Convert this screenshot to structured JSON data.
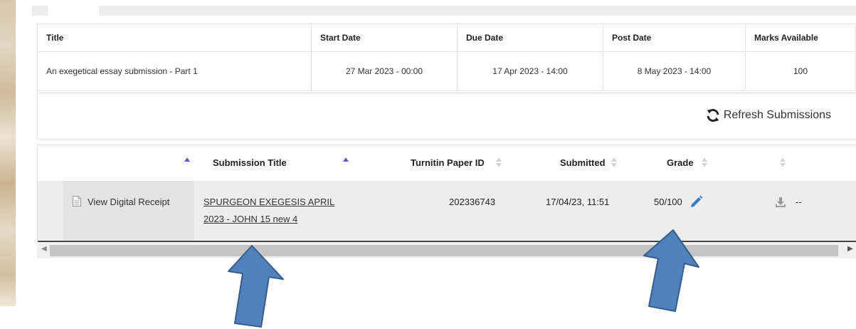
{
  "assignment": {
    "headers": {
      "title": "Title",
      "start_date": "Start Date",
      "due_date": "Due Date",
      "post_date": "Post Date",
      "marks_available": "Marks Available"
    },
    "row": {
      "title": "An exegetical essay submission - Part 1",
      "start_date": "27 Mar 2023 - 00:00",
      "due_date": "17 Apr 2023 - 14:00",
      "post_date": "8 May 2023 - 14:00",
      "marks_available": "100"
    }
  },
  "toolbar": {
    "refresh_label": "Refresh Submissions"
  },
  "submissions": {
    "headers": {
      "submission_title": "Submission Title",
      "paper_id": "Turnitin Paper ID",
      "submitted": "Submitted",
      "grade": "Grade"
    },
    "row": {
      "receipt_label": "View Digital Receipt",
      "title_line1": "SPURGEON EXEGESIS APRIL",
      "title_line2": "2023 - JOHN 15 new 4",
      "paper_id": "202336743",
      "submitted": "17/04/23, 11:51",
      "grade": "50/100",
      "extra": "--"
    }
  },
  "colors": {
    "arrow_fill": "#4f81bd",
    "arrow_stroke": "#385d8a",
    "sort_active": "#5b5bd6",
    "pencil": "#3a7bc8"
  },
  "icons": [
    "refresh-icon",
    "document-icon",
    "pencil-icon",
    "download-icon",
    "sort-icon"
  ]
}
